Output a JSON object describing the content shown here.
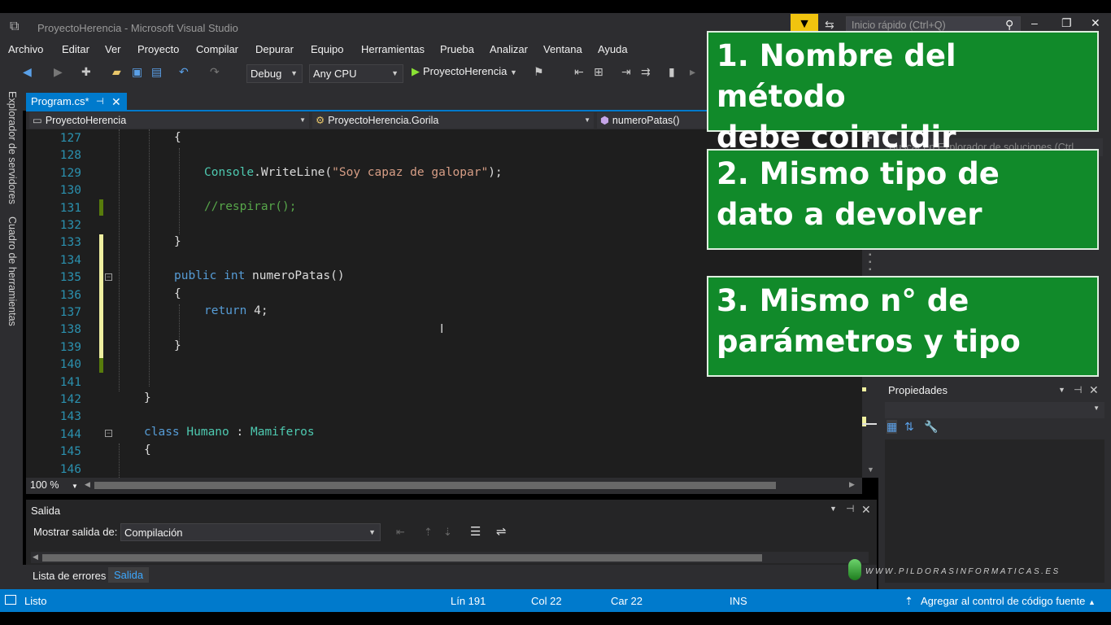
{
  "window": {
    "title": "ProyectoHerencia - Microsoft Visual Studio",
    "quick_launch_placeholder": "Inicio rápido (Ctrl+Q)"
  },
  "menu": [
    "Archivo",
    "Editar",
    "Ver",
    "Proyecto",
    "Compilar",
    "Depurar",
    "Equipo",
    "Herramientas",
    "Prueba",
    "Analizar",
    "Ventana",
    "Ayuda"
  ],
  "toolbar": {
    "config": "Debug",
    "platform": "Any CPU",
    "start_project": "ProyectoHerencia"
  },
  "side_tabs": [
    "Explorador de servidores",
    "Cuadro de herramientas"
  ],
  "document_tab": {
    "name": "Program.cs*"
  },
  "navbar": {
    "project": "ProyectoHerencia",
    "class": "ProyectoHerencia.Gorila",
    "member": "numeroPatas()"
  },
  "editor": {
    "line_numbers": [
      "127",
      "128",
      "129",
      "130",
      "131",
      "132",
      "133",
      "134",
      "135",
      "136",
      "137",
      "138",
      "139",
      "140",
      "141",
      "142",
      "143",
      "144",
      "145",
      "146"
    ],
    "zoom": "100 %"
  },
  "output": {
    "title": "Salida",
    "show_output_label": "Mostrar salida de:",
    "show_output_value": "Compilación"
  },
  "bottom_tabs": {
    "errors": "Lista de errores",
    "output": "Salida"
  },
  "right": {
    "solution_search_placeholder": "Buscar en Explorador de soluciones (Ctrl",
    "properties_title": "Propiedades"
  },
  "callouts": [
    {
      "line1": "1. Nombre del método",
      "line2": "debe coincidir"
    },
    {
      "line1": "2. Mismo tipo de",
      "line2": "dato a devolver"
    },
    {
      "line1": "3. Mismo n° de",
      "line2": "parámetros y tipo"
    }
  ],
  "watermark": "WWW.PILDORASINFORMATICAS.ES",
  "status": {
    "ready": "Listo",
    "line": "Lín 191",
    "col": "Col 22",
    "car": "Car 22",
    "mode": "INS",
    "source_control": "Agregar al control de código fuente"
  },
  "colors": {
    "accent": "#007acc",
    "callout_bg": "#118a2a",
    "keyword": "#569cd6",
    "string": "#d69d85",
    "comment": "#57a64a",
    "type": "#4ec9b0",
    "line_number": "#2b91af"
  }
}
